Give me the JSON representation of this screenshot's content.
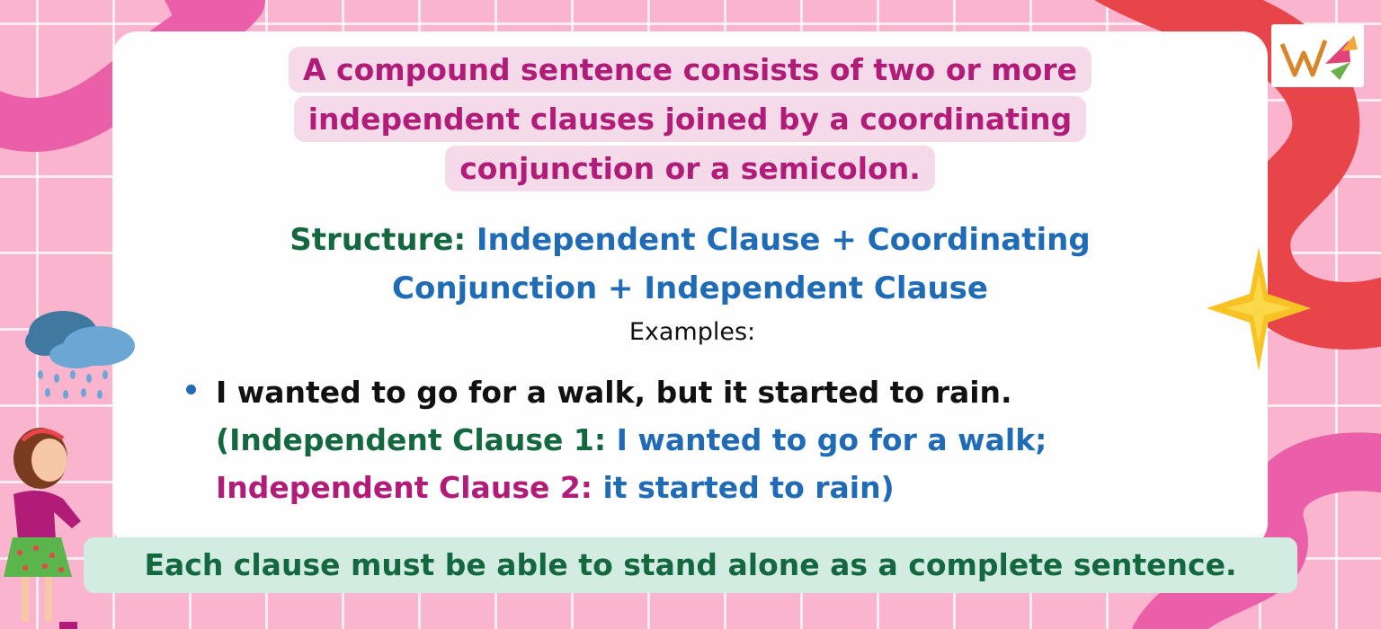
{
  "definition": {
    "lines": [
      "A compound sentence consists of two or more",
      "independent clauses joined by a coordinating",
      "conjunction or a semicolon."
    ]
  },
  "structure": {
    "label": "Structure:",
    "line1_text": "Independent Clause + Coordinating",
    "line2_text": "Conjunction + Independent Clause"
  },
  "examples_label": "Examples:",
  "example": {
    "sentence": "I wanted to go for a walk, but it started to rain.",
    "clause1_label": "(Independent Clause 1:",
    "clause1_text": "I wanted to go for a walk;",
    "clause2_label": "Independent Clause 2:",
    "clause2_text": "it started to rain)"
  },
  "footer_note": "Each clause must be able to stand alone as a complete sentence.",
  "colors": {
    "background_pink": "#fbb4cd",
    "definition_text": "#b11c78",
    "definition_highlight": "#f5dbe9",
    "structure_label": "#13683f",
    "structure_text": "#1f6bb6",
    "footer_bg": "#d3ece1",
    "footer_text": "#13683f"
  },
  "icons": [
    "logo-icon",
    "rain-cloud-icon",
    "star-icon",
    "girl-illustration"
  ]
}
